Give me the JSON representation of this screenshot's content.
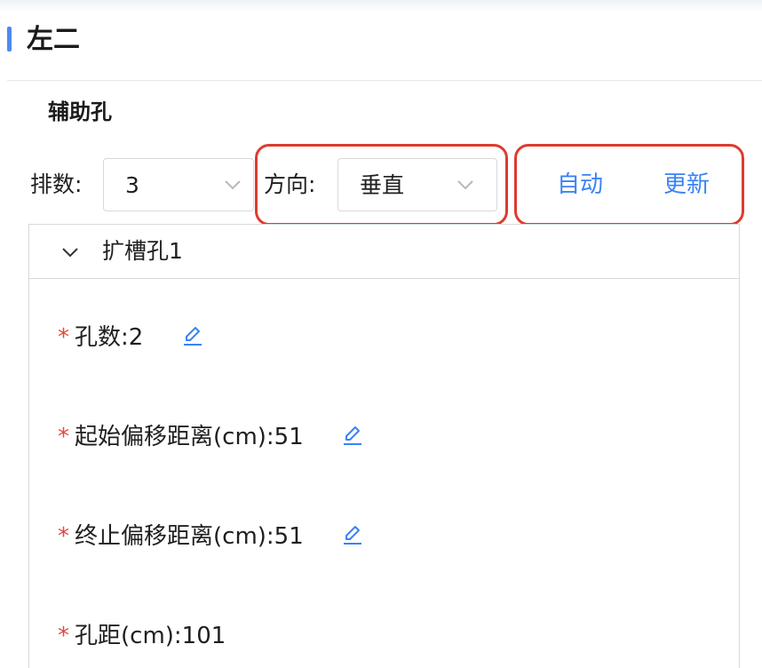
{
  "section": {
    "title": "左二"
  },
  "subsection": {
    "title": "辅助孔"
  },
  "controls": {
    "rows_label": "排数:",
    "rows_value": "3",
    "direction_label": "方向:",
    "direction_value": "垂直",
    "auto_button": "自动",
    "update_button": "更新"
  },
  "panel": {
    "title": "扩槽孔1",
    "expanded": true,
    "fields": [
      {
        "label": "孔数:",
        "value": "2",
        "editable": true,
        "required": true
      },
      {
        "label": "起始偏移距离(cm):",
        "value": "51",
        "editable": true,
        "required": true
      },
      {
        "label": "终止偏移距离(cm):",
        "value": "51",
        "editable": true,
        "required": true
      },
      {
        "label": "孔距(cm):",
        "value": "101",
        "editable": false,
        "required": true
      }
    ]
  },
  "colors": {
    "accent": "#4f88ee",
    "link": "#3b82f6",
    "required": "#e8463c",
    "highlight_box": "#de3b2f"
  }
}
